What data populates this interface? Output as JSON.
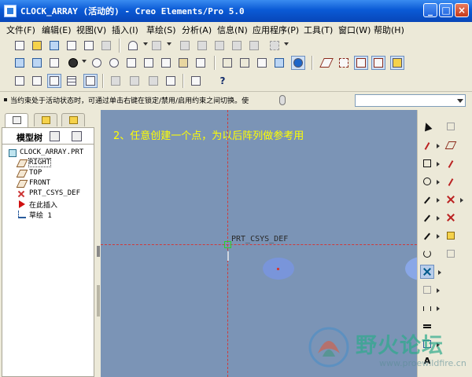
{
  "window": {
    "title": "CLOCK_ARRAY (活动的) - Creo Elements/Pro 5.0",
    "controls": {
      "minimize": "_",
      "maximize": "□",
      "close": "×"
    }
  },
  "menu": [
    "文件(F)",
    "编辑(E)",
    "视图(V)",
    "插入(I)",
    "草绘(S)",
    "分析(A)",
    "信息(N)",
    "应用程序(P)",
    "工具(T)",
    "窗口(W)",
    "帮助(H)"
  ],
  "toolbar": {
    "help_glyph": "?"
  },
  "message_bar": {
    "text": "当约束处于活动状态时，可通过单击右键在锁定/禁用/启用约束之间切换。使"
  },
  "navigator": {
    "header_label": "模型树",
    "tree": [
      {
        "label": "CLOCK_ARRAY.PRT",
        "icon": "part-icon"
      },
      {
        "label": "RIGHT",
        "icon": "datum-plane-icon",
        "selected": true
      },
      {
        "label": "TOP",
        "icon": "datum-plane-icon"
      },
      {
        "label": "FRONT",
        "icon": "datum-plane-icon"
      },
      {
        "label": "PRT_CSYS_DEF",
        "icon": "csys-icon"
      },
      {
        "label": "在此插入",
        "icon": "insert-here-icon"
      },
      {
        "label": "草绘 1",
        "icon": "sketch-icon"
      }
    ]
  },
  "graphics": {
    "instruction": "2、任意创建一个点，为以后阵列做参考用",
    "csys_label": "PRT_CSYS_DEF",
    "background": "#7b94b6",
    "instruction_color": "#ffff00",
    "axis_color": "#d03a3a"
  },
  "sketch_tools": {
    "text_glyph": "A"
  },
  "watermark": {
    "text": "野火论坛",
    "url": "www.proewildfire.cn"
  }
}
